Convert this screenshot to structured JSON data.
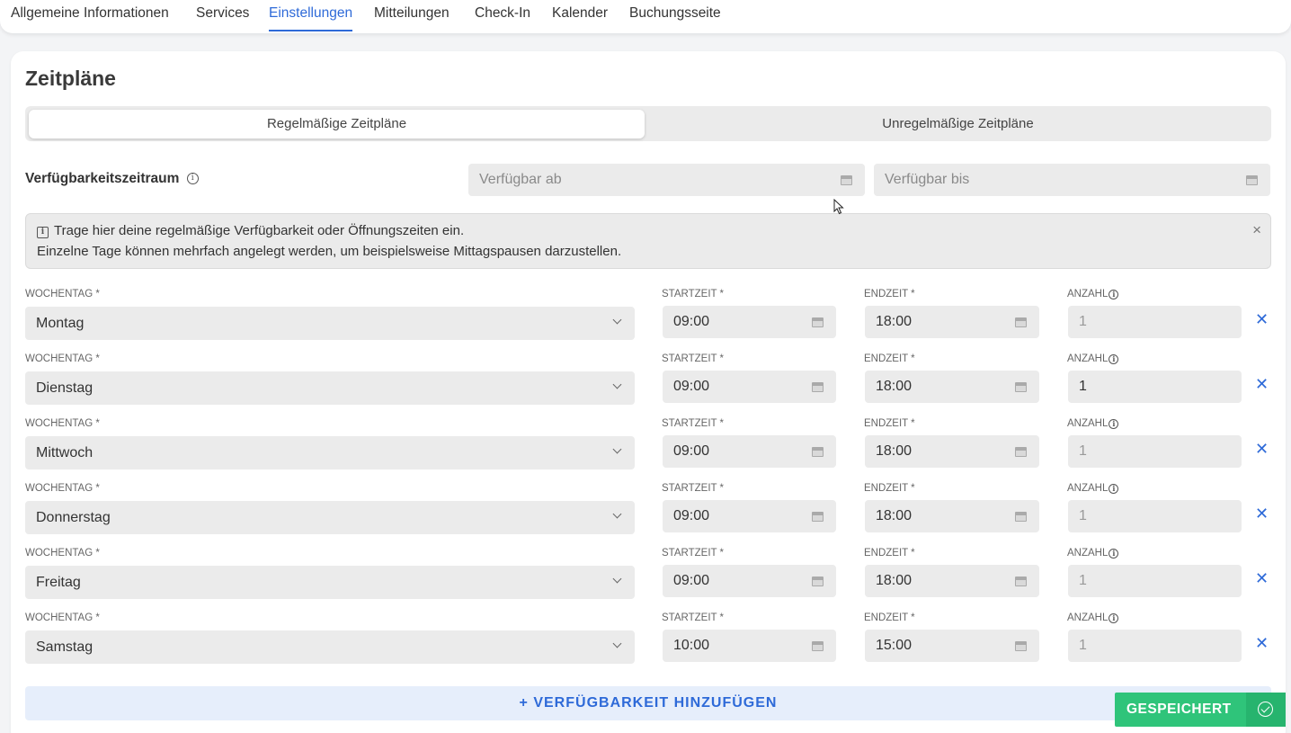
{
  "tabs": [
    "Allgemeine Informationen",
    "Services",
    "Einstellungen",
    "Mitteilungen",
    "Check-In",
    "Kalender",
    "Buchungsseite"
  ],
  "active_tab": "Einstellungen",
  "section_title": "Zeitpläne",
  "segments": {
    "regular": "Regelmäßige Zeitpläne",
    "irregular": "Unregelmäßige Zeitpläne"
  },
  "availability": {
    "label": "Verfügbarkeitszeitraum",
    "from_placeholder": "Verfügbar ab",
    "to_placeholder": "Verfügbar bis"
  },
  "notice": {
    "line1": "Trage hier deine regelmäßige Verfügbarkeit oder Öffnungszeiten ein.",
    "line2": "Einzelne Tage können mehrfach angelegt werden, um beispielsweise Mittagspausen darzustellen.",
    "close": "×"
  },
  "labels": {
    "weekday": "WOCHENTAG *",
    "start": "STARTZEIT *",
    "end": "ENDZEIT *",
    "count": "ANZAHL"
  },
  "rows": [
    {
      "day": "Montag",
      "start": "09:00",
      "end": "18:00",
      "count": "1"
    },
    {
      "day": "Dienstag",
      "start": "09:00",
      "end": "18:00",
      "count": "1"
    },
    {
      "day": "Mittwoch",
      "start": "09:00",
      "end": "18:00",
      "count": "1"
    },
    {
      "day": "Donnerstag",
      "start": "09:00",
      "end": "18:00",
      "count": "1"
    },
    {
      "day": "Freitag",
      "start": "09:00",
      "end": "18:00",
      "count": "1"
    },
    {
      "day": "Samstag",
      "start": "10:00",
      "end": "15:00",
      "count": "1"
    }
  ],
  "remove_symbol": "✕",
  "add_button": "+ VERFÜGBARKEIT HINZUFÜGEN",
  "saved_label": "GESPEICHERT",
  "colors": {
    "accent": "#2e6ad8",
    "success": "#2fc47a",
    "field_bg": "#ebebeb"
  }
}
